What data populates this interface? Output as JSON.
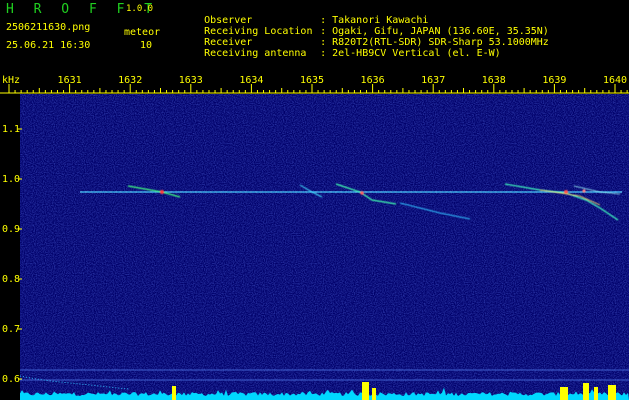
{
  "app": {
    "brand": "H R O F F T",
    "version": "1.0.0",
    "filename": "2506211630.png",
    "datetime": "25.06.21 16:30",
    "meteor_label": "meteor",
    "meteor_count": "10"
  },
  "info": [
    {
      "label": "Observer",
      "sep": ":",
      "value": "Takanori Kawachi"
    },
    {
      "label": "Receiving Location",
      "sep": ":",
      "value": "Ogaki, Gifu, JAPAN (136.60E, 35.35N)"
    },
    {
      "label": "Receiver",
      "sep": ":",
      "value": "R820T2(RTL-SDR) SDR-Sharp 53.1000MHz"
    },
    {
      "label": "Receiving antenna",
      "sep": ":",
      "value": "2el-HB9CV Vertical (el. E-W)"
    }
  ],
  "axis": {
    "unit": "kHz",
    "time_ticks": [
      "1631",
      "1632",
      "1633",
      "1634",
      "1635",
      "1636",
      "1637",
      "1638",
      "1639",
      "1640"
    ],
    "freq_ticks": [
      "1.1",
      "1.0",
      "0.9",
      "0.8",
      "0.7",
      "0.6"
    ]
  },
  "colors": {
    "brand": "#20d020",
    "text": "#ffff00",
    "scale": "#ffff00",
    "background": "#00006a",
    "carrier": "#40c8ff",
    "power_trace": "#00d8ff",
    "burst": "#ffff00"
  }
}
